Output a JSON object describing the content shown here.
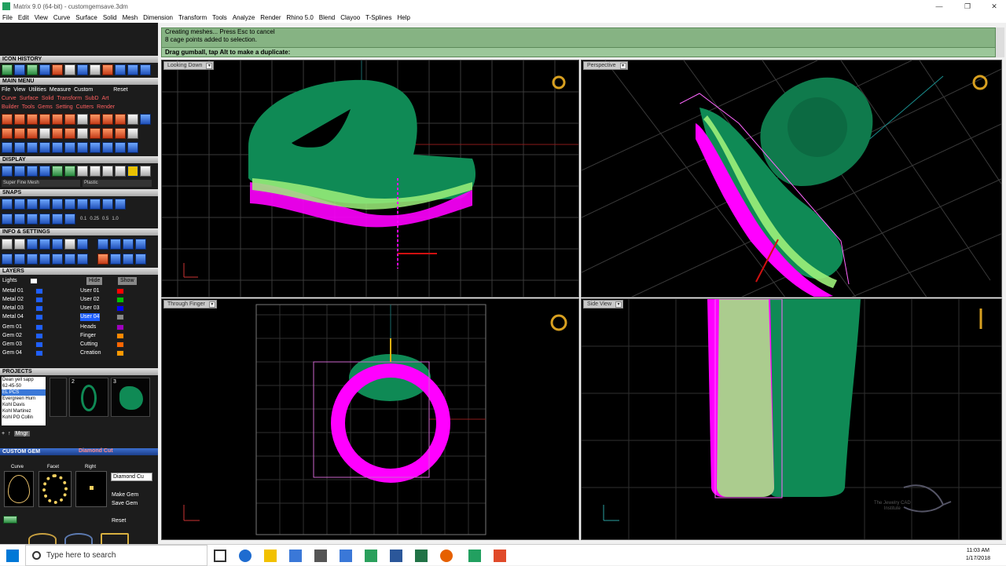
{
  "window": {
    "title": "Matrix 9.0 (64-bit) - customgemsave.3dm"
  },
  "menu": [
    "File",
    "Edit",
    "View",
    "Curve",
    "Surface",
    "Solid",
    "Mesh",
    "Dimension",
    "Transform",
    "Tools",
    "Analyze",
    "Render",
    "Rhino 5.0",
    "Blend",
    "Clayoo",
    "T-Splines",
    "Help"
  ],
  "command": {
    "lines": [
      "Creating meshes... Press Esc to cancel",
      "8 cage points added to selection."
    ],
    "prompt": "Drag gumball, tap Alt to make a duplicate:"
  },
  "panel": {
    "icon_history": "ICON HISTORY",
    "main_menu": "MAIN MENU",
    "reset": "Reset",
    "menu_tabs": [
      "File",
      "View",
      "Utilities",
      "Measure",
      "Custom"
    ],
    "menu_row1": [
      "Curve",
      "Surface",
      "Solid",
      "Transform",
      "SubD",
      "Art"
    ],
    "menu_row2": [
      "Builder",
      "Tools",
      "Gems",
      "Setting",
      "Cutters",
      "Render"
    ],
    "display": "DISPLAY",
    "display_mode": "Super Fine Mesh",
    "display_material": "Plastic",
    "snaps": "SNAPS",
    "snap_values": [
      "0.1",
      "0.25",
      "0.5",
      "1.0"
    ],
    "info": "INFO & SETTINGS",
    "layers": "LAYERS",
    "layer_hide": "Hide",
    "layer_show": "Show",
    "layers_left": [
      "Lights",
      "Metal 01",
      "Metal 02",
      "Metal 03",
      "Metal 04",
      "Gem 01",
      "Gem 02",
      "Gem 03",
      "Gem 04"
    ],
    "layers_right": [
      "User 01",
      "User 02",
      "User 03",
      "User 04",
      "Heads",
      "Finger",
      "Cutting",
      "Creation"
    ],
    "projects": "PROJECTS",
    "project_list": [
      "Dean yell sapp",
      "62-45-50",
      "EL PCS",
      "Evergreen Hum",
      "Kohl Davis",
      "Kohl Martinez",
      "Kohl PO Collin"
    ],
    "project_nums": [
      "2",
      "3"
    ],
    "manager": "Mngr",
    "custom_gem": "CUSTOM GEM",
    "diamond_cut": "Diamond Cut",
    "gem_tabs": [
      "Curve",
      "Facet",
      "Right"
    ],
    "gem_field": "Diamond Cu",
    "make_gem": "Make Gem",
    "save_gem": "Save Gem",
    "gem_reset": "Reset"
  },
  "viewports": {
    "tl": "Looking Down",
    "tr": "Perspective",
    "bl": "Through Finger",
    "br": "Side View",
    "watermark": [
      "The Jewelry CAD",
      "Institute"
    ]
  },
  "colors": {
    "metal": "#0f8a55",
    "selection": "#ff00ff",
    "wire": "#9cf07a",
    "cmd": "#86b383"
  },
  "taskbar": {
    "search": "Type here to search",
    "time": "11:03 AM",
    "date": "1/17/2018"
  }
}
